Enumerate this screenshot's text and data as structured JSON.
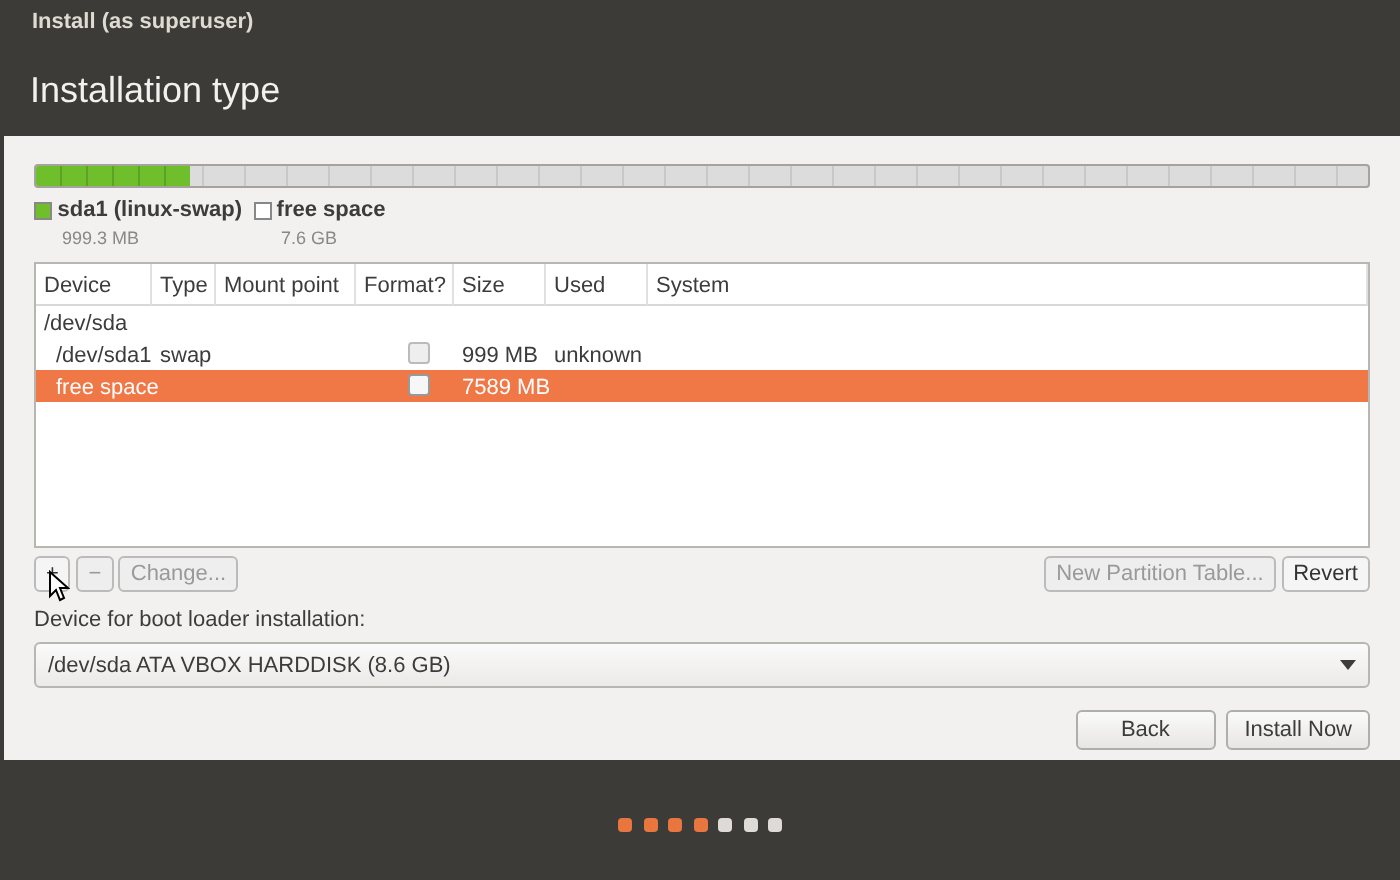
{
  "window": {
    "title": "Install (as superuser)"
  },
  "page_title": "Installation type",
  "partition_bar": {
    "level": 0.116,
    "color": "#6fbe2c"
  },
  "legend": [
    {
      "name": "sda1 (linux-swap)",
      "size": "999.3 MB",
      "color": "#6fbe2c"
    },
    {
      "name": "free space",
      "size": "7.6 GB",
      "color": "#ffffff"
    }
  ],
  "table": {
    "columns": [
      "Device",
      "Type",
      "Mount point",
      "Format?",
      "Size",
      "Used",
      "System"
    ],
    "rows": [
      {
        "device": "/dev/sda",
        "selected": false,
        "children": [
          {
            "device": "/dev/sda1",
            "type": "swap",
            "format": {
              "checked": false,
              "disabled": true
            },
            "size": "999 MB",
            "used": "unknown",
            "selected": false
          },
          {
            "device": "free space",
            "format": {
              "checked": false,
              "disabled": false
            },
            "size": "7589 MB",
            "selected": true
          }
        ]
      }
    ]
  },
  "partition_buttons": [
    {
      "label": "+",
      "disabled": false
    },
    {
      "label": "−",
      "disabled": true
    },
    {
      "label": "Change...",
      "disabled": true
    }
  ],
  "table_buttons": [
    {
      "label": "New Partition Table...",
      "disabled": true
    },
    {
      "label": "Revert",
      "disabled": false
    }
  ],
  "boot_loader": {
    "label": "Device for boot loader installation:",
    "value": "/dev/sda ATA VBOX HARDDISK (8.6 GB)"
  },
  "buttons": [
    {
      "label": "Back"
    },
    {
      "label": "Install Now"
    }
  ],
  "steps": [
    {
      "done": true
    },
    {
      "done": true
    },
    {
      "done": true
    },
    {
      "done": true
    },
    {
      "done": false
    },
    {
      "done": false
    },
    {
      "done": false
    }
  ]
}
